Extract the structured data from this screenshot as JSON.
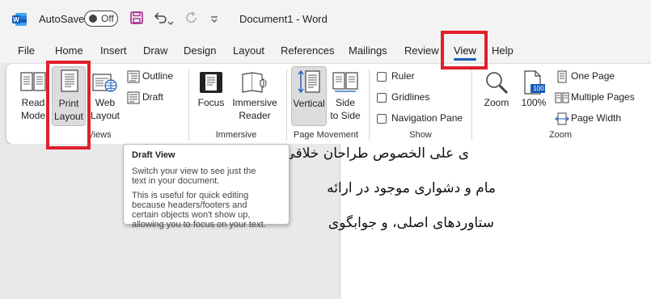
{
  "titlebar": {
    "autosave_label": "AutoSave",
    "autosave_state": "Off",
    "document_title": "Document1  -  Word"
  },
  "tabs": [
    "File",
    "Home",
    "Insert",
    "Draw",
    "Design",
    "Layout",
    "References",
    "Mailings",
    "Review",
    "View",
    "Help"
  ],
  "active_tab": "View",
  "ribbon": {
    "views": {
      "group_label": "Views",
      "read_mode": [
        "Read",
        "Mode"
      ],
      "print_layout": [
        "Print",
        "Layout"
      ],
      "web_layout": [
        "Web",
        "Layout"
      ],
      "outline": "Outline",
      "draft": "Draft"
    },
    "immersive": {
      "group_label": "Immersive",
      "focus": "Focus",
      "immersive_reader": [
        "Immersive",
        "Reader"
      ]
    },
    "page_movement": {
      "group_label": "Page Movement",
      "vertical": "Vertical",
      "side_to_side": [
        "Side",
        "to Side"
      ]
    },
    "show": {
      "group_label": "Show",
      "ruler": "Ruler",
      "gridlines": "Gridlines",
      "navigation_pane": "Navigation Pane"
    },
    "zoom": {
      "group_label": "Zoom",
      "zoom": "Zoom",
      "percent": "100%",
      "percent_icon_text": "100",
      "one_page": "One Page",
      "multiple_pages": "Multiple Pages",
      "page_width": "Page Width"
    }
  },
  "tooltip": {
    "title": "Draft View",
    "line1": "Switch your view to see just the",
    "line2": "text in your document.",
    "line3": "This is useful for quick editing",
    "line4": "because headers/footers and",
    "line5": "certain objects won't show up,",
    "line6": "allowing you to focus on your text."
  },
  "document": {
    "line1": "ی علی الخصوص طراحان خلاقی، و",
    "line2": "مام و دشواری موجود در ارائه",
    "line3": "ستاوردهای اصلی، و جوابگوی"
  },
  "colors": {
    "highlight_border": "#e0202c",
    "active_tab_underline": "#185abd",
    "word_brand": "#185abd"
  }
}
